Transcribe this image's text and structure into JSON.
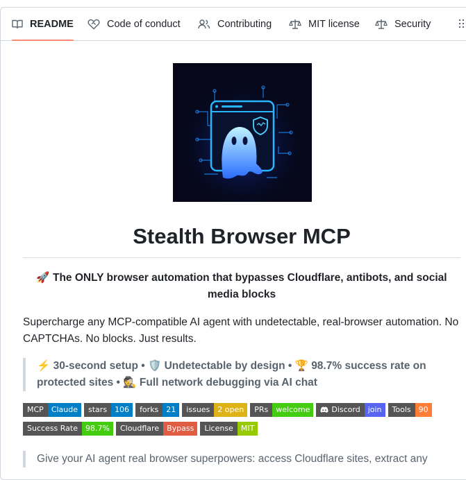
{
  "tabs": [
    {
      "label": "README",
      "icon": "book-icon",
      "active": true
    },
    {
      "label": "Code of conduct",
      "icon": "heart-handshake-icon"
    },
    {
      "label": "Contributing",
      "icon": "people-icon"
    },
    {
      "label": "MIT license",
      "icon": "law-icon"
    },
    {
      "label": "Security",
      "icon": "law-icon"
    }
  ],
  "readme": {
    "title": "Stealth Browser MCP",
    "tagline": "🚀 The ONLY browser automation that bypasses Cloudflare, antibots, and social media blocks",
    "intro": "Supercharge any MCP-compatible AI agent with undetectable, real-browser automation. No CAPTCHAs. No blocks. Just results.",
    "highlights": "⚡ 30-second setup • 🛡️ Undetectable by design • 🏆 98.7% success rate on protected sites • 🕵️ Full network debugging via AI chat",
    "next_quote": "Give your AI agent real browser superpowers: access Cloudflare sites, extract any"
  },
  "badges": [
    [
      {
        "label": "MCP",
        "value": "Claude",
        "color": "#007ec6"
      },
      {
        "label": "stars",
        "value": "106",
        "color": "#007ec6"
      },
      {
        "label": "forks",
        "value": "21",
        "color": "#007ec6"
      },
      {
        "label": "issues",
        "value": "2 open",
        "color": "#dfb317"
      },
      {
        "label": "PRs",
        "value": "welcome",
        "color": "#4c1"
      },
      {
        "label": "Discord",
        "value": "join",
        "color": "#5865f2",
        "icon": "discord-icon"
      },
      {
        "label": "Tools",
        "value": "90",
        "color": "#fe7d37"
      }
    ],
    [
      {
        "label": "Success Rate",
        "value": "98.7%",
        "color": "#4c1"
      },
      {
        "label": "Cloudflare",
        "value": "Bypass",
        "color": "#e05d44"
      },
      {
        "label": "License",
        "value": "MIT",
        "color": "#97ca00"
      }
    ]
  ],
  "colors": {
    "accent_underline": "#fd8c73",
    "border": "#d0d7de"
  }
}
